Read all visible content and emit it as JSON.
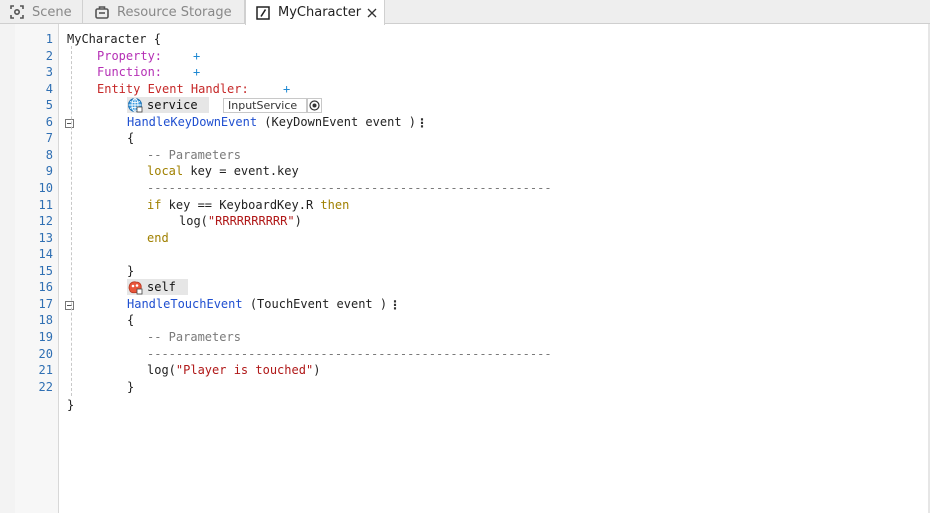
{
  "tabs": [
    {
      "label": "Scene",
      "icon": "scene-icon"
    },
    {
      "label": "Resource Storage",
      "icon": "resource-storage-icon"
    },
    {
      "label": "MyCharacter",
      "icon": "script-icon",
      "active": true
    }
  ],
  "line_numbers": [
    "1",
    "2",
    "3",
    "4",
    "5",
    "6",
    "7",
    "8",
    "9",
    "10",
    "11",
    "12",
    "13",
    "14",
    "15",
    "16",
    "17",
    "18",
    "19",
    "20",
    "21",
    "22"
  ],
  "editor": {
    "component_name": "MyCharacter",
    "open_brace": "{",
    "close_brace": "}",
    "property_label": "Property:",
    "function_label": "Function:",
    "entity_event_handler_label": "Entity Event Handler:",
    "add_symbol": "+",
    "more_symbol": "⋮",
    "handlers": [
      {
        "target": "service",
        "target_icon": "globe-icon",
        "service_select": "InputService",
        "name": "HandleKeyDownEvent",
        "params": "(KeyDownEvent event )",
        "open": "{",
        "comment": "-- Parameters",
        "local_kw": "local",
        "local_rest": " key = event.key",
        "separator": "--------------------------------------------------------",
        "if_kw": "if",
        "cond": " key == KeyboardKey.R ",
        "then_kw": "then",
        "call_fn": "log(",
        "call_str": "\"RRRRRRRRRR\"",
        "call_close": ")",
        "end_kw": "end",
        "close": "}"
      },
      {
        "target": "self",
        "target_icon": "self-entity-icon",
        "name": "HandleTouchEvent",
        "params": "(TouchEvent event )",
        "open": "{",
        "comment": "-- Parameters",
        "separator": "--------------------------------------------------------",
        "call_fn": "log(",
        "call_str": "\"Player is touched\"",
        "call_close": ")",
        "close": "}"
      }
    ]
  },
  "colors": {
    "line_number": "#2f6fb3",
    "property": "#b52fb5",
    "entity_event": "#c62828",
    "function_name": "#1f4fd0",
    "keyword": "#a08000",
    "string": "#b01818",
    "comment": "#7a7a7a",
    "plus": "#1e88d2"
  }
}
